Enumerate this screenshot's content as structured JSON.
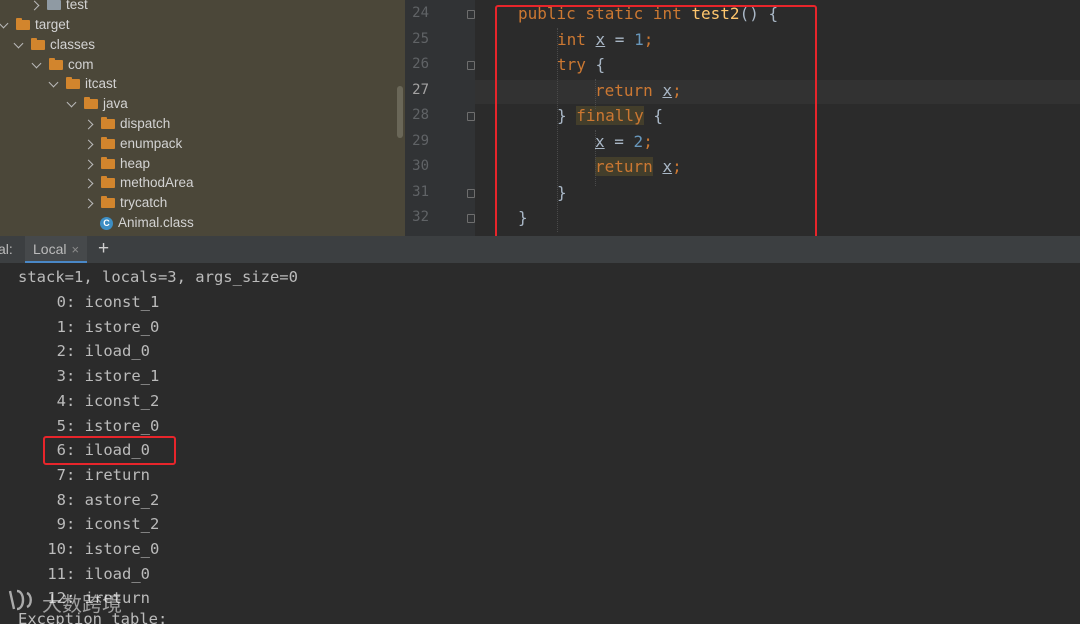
{
  "project_tree": {
    "items": [
      {
        "label": "test",
        "depth": 1,
        "expanded": false,
        "icon": "folder-icon",
        "color": "#8f9aa3"
      },
      {
        "label": "target",
        "depth": 0,
        "expanded": true,
        "icon": "folder-icon",
        "color": "#d2852d"
      },
      {
        "label": "classes",
        "depth": 1,
        "expanded": true,
        "icon": "folder-icon",
        "color": "#d2852d"
      },
      {
        "label": "com",
        "depth": 2,
        "expanded": true,
        "icon": "folder-icon",
        "color": "#d2852d"
      },
      {
        "label": "itcast",
        "depth": 3,
        "expanded": true,
        "icon": "folder-icon",
        "color": "#d2852d"
      },
      {
        "label": "java",
        "depth": 4,
        "expanded": true,
        "icon": "folder-icon",
        "color": "#d2852d"
      },
      {
        "label": "dispatch",
        "depth": 5,
        "expanded": false,
        "icon": "folder-icon",
        "color": "#d2852d"
      },
      {
        "label": "enumpack",
        "depth": 5,
        "expanded": false,
        "icon": "folder-icon",
        "color": "#d2852d"
      },
      {
        "label": "heap",
        "depth": 5,
        "expanded": false,
        "icon": "folder-icon",
        "color": "#d2852d"
      },
      {
        "label": "methodArea",
        "depth": 5,
        "expanded": false,
        "icon": "folder-icon",
        "color": "#d2852d"
      },
      {
        "label": "trycatch",
        "depth": 5,
        "expanded": false,
        "icon": "folder-icon",
        "color": "#d2852d"
      },
      {
        "label": "Animal.class",
        "depth": 5,
        "expanded": null,
        "icon": "class-file-icon",
        "badge": "C"
      }
    ]
  },
  "editor": {
    "current_line": "27",
    "lines": [
      {
        "number": "24",
        "tokens": [
          [
            "kw",
            "public static int "
          ],
          [
            "fn",
            "test2"
          ],
          [
            "p",
            "() {"
          ]
        ]
      },
      {
        "number": "25",
        "tokens": [
          [
            "kw",
            "int "
          ],
          [
            "var",
            "x"
          ],
          [
            "p",
            " = "
          ],
          [
            "num",
            "1"
          ],
          [
            "kw",
            ";"
          ]
        ]
      },
      {
        "number": "26",
        "tokens": [
          [
            "kw",
            "try "
          ],
          [
            "p",
            "{"
          ]
        ]
      },
      {
        "number": "27",
        "tokens": [
          [
            "kw",
            "return "
          ],
          [
            "var",
            "x"
          ],
          [
            "kw",
            ";"
          ]
        ]
      },
      {
        "number": "28",
        "tokens": [
          [
            "p",
            "} "
          ],
          [
            "kwhl",
            "finally"
          ],
          [
            "p",
            " {"
          ]
        ]
      },
      {
        "number": "29",
        "tokens": [
          [
            "var",
            "x"
          ],
          [
            "p",
            " = "
          ],
          [
            "num",
            "2"
          ],
          [
            "kw",
            ";"
          ]
        ]
      },
      {
        "number": "30",
        "tokens": [
          [
            "kwhl",
            "return"
          ],
          [
            "p",
            " "
          ],
          [
            "var",
            "x"
          ],
          [
            "kw",
            ";"
          ]
        ]
      },
      {
        "number": "31",
        "tokens": [
          [
            "p",
            "}"
          ]
        ]
      },
      {
        "number": "32",
        "tokens": [
          [
            "p",
            "}"
          ]
        ]
      }
    ]
  },
  "terminal_tabs": {
    "prefix": "al:",
    "active_tab": "Local",
    "close_glyph": "×",
    "add_glyph": "+"
  },
  "terminal": {
    "header": "stack=1, locals=3, args_size=0",
    "instructions": [
      {
        "index": "0",
        "op": "iconst_1"
      },
      {
        "index": "1",
        "op": "istore_0"
      },
      {
        "index": "2",
        "op": "iload_0"
      },
      {
        "index": "3",
        "op": "istore_1"
      },
      {
        "index": "4",
        "op": "iconst_2"
      },
      {
        "index": "5",
        "op": "istore_0"
      },
      {
        "index": "6",
        "op": "iload_0",
        "highlighted": true
      },
      {
        "index": "7",
        "op": "ireturn"
      },
      {
        "index": "8",
        "op": "astore_2"
      },
      {
        "index": "9",
        "op": "iconst_2"
      },
      {
        "index": "10",
        "op": "istore_0"
      },
      {
        "index": "11",
        "op": "iload_0"
      },
      {
        "index": "12",
        "op": "ireturn"
      }
    ],
    "footer": "Exception table:"
  },
  "watermark": {
    "text": "大数跨境"
  },
  "colors": {
    "keyword": "#cc7832",
    "function": "#ffc66d",
    "number": "#6897bb",
    "text": "#a9b7c6",
    "annotation_box": "#e8252b"
  }
}
